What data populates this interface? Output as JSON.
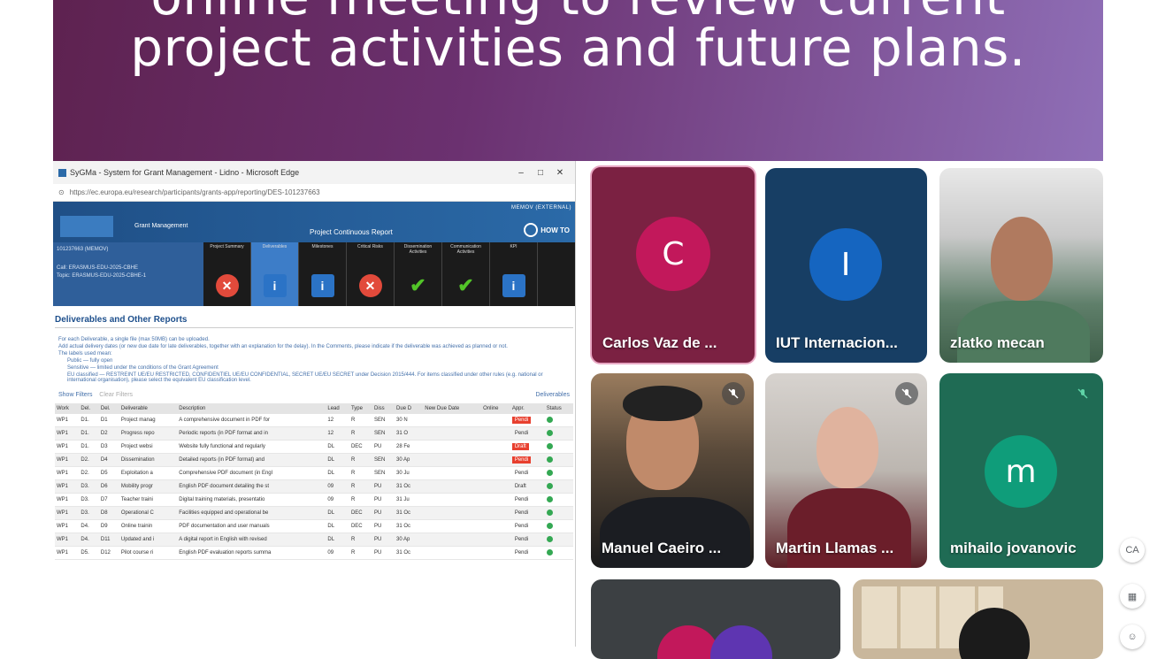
{
  "banner": {
    "line1": "online meeting to review current",
    "line2": "project activities and future plans."
  },
  "share": {
    "window_title": "SyGMa - System for Grant Management - Lidno - Microsoft Edge",
    "url": "https://ec.europa.eu/research/participants/grants-app/reporting/DES-101237663",
    "header_top": "MEMOV (EXTERNAL)",
    "app_name": "Grant Management",
    "center_title": "Project Continuous Report",
    "howto": "HOW TO",
    "proj_lines": [
      "101237663 (MEMOV)",
      "Call: ERASMUS-EDU-2025-CBHE",
      "Topic: ERASMUS-EDU-2025-CBHE-1"
    ],
    "steps": [
      {
        "label": "Project Summary",
        "icon": "x"
      },
      {
        "label": "Deliverables",
        "icon": "i",
        "active": true
      },
      {
        "label": "Milestones",
        "icon": "i"
      },
      {
        "label": "Critical Risks",
        "icon": "x"
      },
      {
        "label": "Dissemination Activities",
        "icon": "ok"
      },
      {
        "label": "Communication Activities",
        "icon": "ok"
      },
      {
        "label": "KPI",
        "icon": "i"
      }
    ],
    "section_title": "Deliverables and Other Reports",
    "notes": [
      "For each Deliverable, a single file (max 50MB) can be uploaded.",
      "Add actual delivery dates (or new due date for late deliverables, together with an explanation for the delay). In the Comments, please indicate if the deliverable was achieved as planned or not.",
      "The labels used mean:",
      "Public — fully open",
      "Sensitive — limited under the conditions of the Grant Agreement",
      "EU classified — RESTREINT UE/EU RESTRICTED, CONFIDENTIEL UE/EU CONFIDENTIAL, SECRET UE/EU SECRET under Decision 2015/444. For items classified under other rules (e.g. national or international organisation), please select the equivalent EU classification level."
    ],
    "show_filters": "Show Filters",
    "clear_filters": "Clear Filters",
    "deliverables_link": "Deliverables",
    "table_headers": [
      "Work",
      "Del.",
      "Del.",
      "Deliverable",
      "Description",
      "Lead",
      "Type",
      "Diss",
      "Due D",
      "New Due Date",
      "Online",
      "Appr.",
      "Status"
    ],
    "rows": [
      [
        "WP1",
        "D1.",
        "D1",
        "Project manag",
        "A comprehensive document in PDF for",
        "12",
        "R",
        "SEN",
        "30 N",
        "Pendi"
      ],
      [
        "WP1",
        "D1.",
        "D2",
        "Progress repo",
        "Periodic reports (in PDF format and in",
        "12",
        "R",
        "SEN",
        "31 O",
        "Pendi"
      ],
      [
        "WP1",
        "D1.",
        "D3",
        "Project websi",
        "Website fully functional and regularly",
        "DL",
        "DEC",
        "PU",
        "28 Fe",
        "Draft"
      ],
      [
        "WP1",
        "D2.",
        "D4",
        "Dissemination",
        "Detailed reports (in PDF format) and",
        "DL",
        "R",
        "SEN",
        "30 Ap",
        "Pendi"
      ],
      [
        "WP1",
        "D2.",
        "D5",
        "Exploitation a",
        "Comprehensive PDF document (in Engl",
        "DL",
        "R",
        "SEN",
        "30 Ju",
        "Pendi"
      ],
      [
        "WP1",
        "D3.",
        "D6",
        "Mobility progr",
        "English PDF document detailing the st",
        "09",
        "R",
        "PU",
        "31 Oc",
        "Draft"
      ],
      [
        "WP1",
        "D3.",
        "D7",
        "Teacher traini",
        "Digital training materials, presentatio",
        "09",
        "R",
        "PU",
        "31 Ju",
        "Pendi"
      ],
      [
        "WP1",
        "D3.",
        "D8",
        "Operational C",
        "Facilities equipped and operational be",
        "DL",
        "DEC",
        "PU",
        "31 Oc",
        "Pendi"
      ],
      [
        "WP1",
        "D4.",
        "D9",
        "Online trainin",
        "PDF documentation and user manuals",
        "DL",
        "DEC",
        "PU",
        "31 Oc",
        "Pendi"
      ],
      [
        "WP1",
        "D4.",
        "D11",
        "Updated and i",
        "A digital report in English with revised",
        "DL",
        "R",
        "PU",
        "30 Ap",
        "Pendi"
      ],
      [
        "WP1",
        "D5.",
        "D12",
        "Pilot course ri",
        "English PDF evaluation reports summa",
        "09",
        "R",
        "PU",
        "31 Oc",
        "Pendi"
      ]
    ]
  },
  "participants": [
    {
      "name": "Carlos Vaz de ...",
      "initial": "C",
      "avatar_color": "#c2185b"
    },
    {
      "name": "IUT Internacion...",
      "initial": "I",
      "avatar_color": "#1565c0"
    },
    {
      "name": "zlatko mecan"
    },
    {
      "name": "Manuel Caeiro ..."
    },
    {
      "name": "Martin Llamas ..."
    },
    {
      "name": "mihailo jovanovic",
      "initial": "m",
      "avatar_color": "#0f9d7a"
    }
  ],
  "colors": {
    "banner_start": "#5e2250",
    "banner_end": "#8f6fb7",
    "active_speaker_border": "#e8a7c3"
  }
}
